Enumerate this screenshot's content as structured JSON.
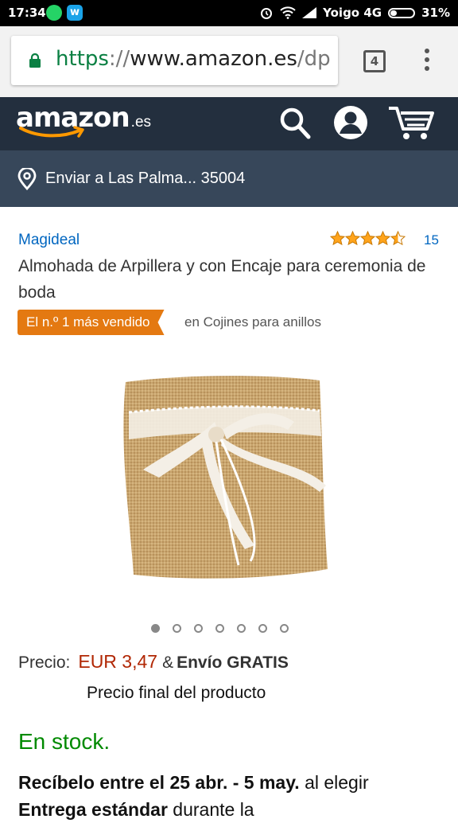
{
  "status_bar": {
    "time": "17:34",
    "carrier": "Yoigo 4G",
    "battery": "31%",
    "icons": [
      "whatsapp-icon",
      "app-w-icon",
      "alarm-icon",
      "wifi-icon",
      "signal-icon",
      "battery-icon"
    ]
  },
  "browser": {
    "url_scheme": "https",
    "url_sep": "://",
    "url_host": "www.amazon.es",
    "url_path": "/dp",
    "tab_count": "4"
  },
  "amazon_header": {
    "logo_word": "amazon",
    "logo_tld": ".es"
  },
  "location": {
    "text": "Enviar a Las Palma... 35004"
  },
  "product": {
    "brand": "Magideal",
    "rating": 4.5,
    "rating_count": "15",
    "title": "Almohada de Arpillera y con Encaje para ceremonia de boda",
    "badge_label": "El n.º 1 más vendido",
    "badge_category": "en Cojines para anillos",
    "image_count": 7,
    "active_image": 1,
    "price_label": "Precio:",
    "price_value": "EUR 3,47",
    "price_amp": "&",
    "shipping": "Envío GRATIS",
    "final_price_note": "Precio final del producto",
    "stock": "En stock.",
    "delivery_bold_1": "Recíbelo entre el 25 abr. - 5 may.",
    "delivery_text_1": " al elegir ",
    "delivery_bold_2": "Entrega estándar",
    "delivery_text_2": " durante la"
  },
  "colors": {
    "amazon_header": "#232f3e",
    "location_bar": "#37475a",
    "badge": "#e47911",
    "price": "#b12704",
    "stock": "#008a00",
    "link": "#0066c0"
  }
}
